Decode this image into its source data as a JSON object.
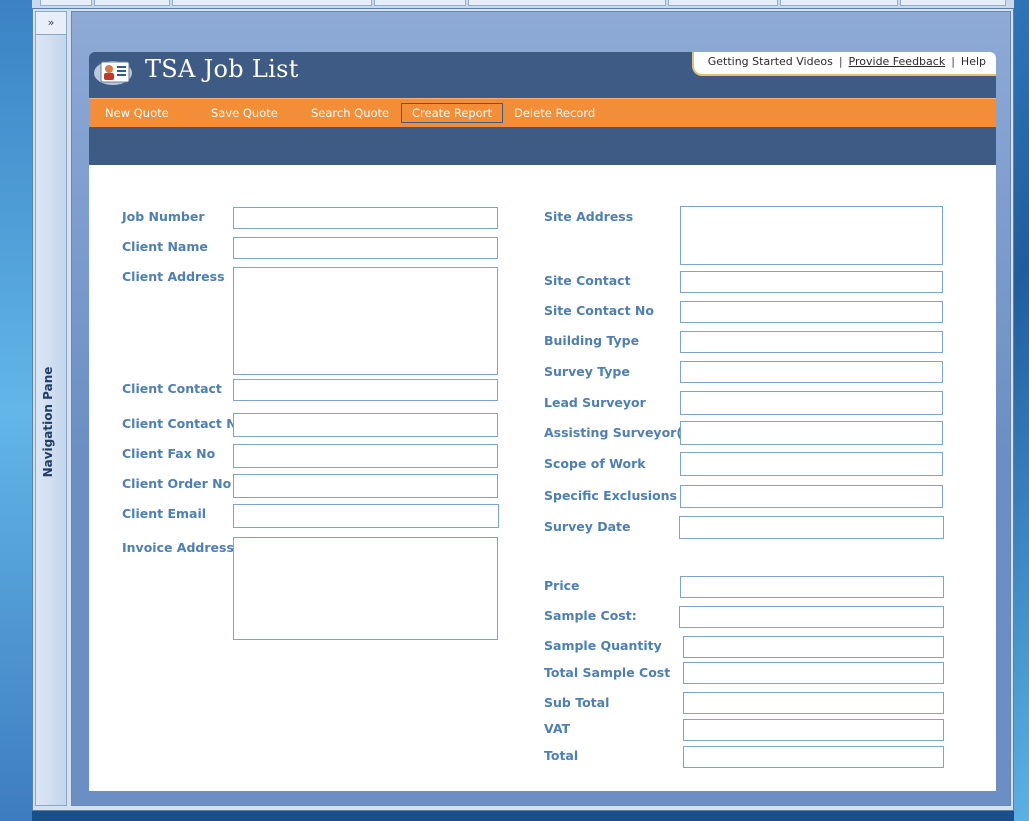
{
  "nav_pane": {
    "toggle": "»",
    "label": "Navigation Pane"
  },
  "header": {
    "title": "TSA Job List",
    "links": [
      "Getting Started Videos",
      "Provide Feedback",
      "Help"
    ]
  },
  "toolbar": {
    "new_quote": "New Quote",
    "save_quote": "Save Quote",
    "search_quote": "Search Quote",
    "create_report": "Create Report",
    "delete_record": "Delete Record"
  },
  "form": {
    "left": {
      "job_number": "Job Number",
      "client_name": "Client Name",
      "client_address": "Client Address",
      "client_contact": "Client Contact",
      "client_contact_no": "Client Contact No",
      "client_fax_no": "Client Fax No",
      "client_order_no": "Client Order No",
      "client_email": "Client Email",
      "invoice_address": "Invoice Address"
    },
    "right": {
      "site_address": "Site Address",
      "site_contact": "Site Contact",
      "site_contact_no": "Site Contact No",
      "building_type": "Building Type",
      "survey_type": "Survey Type",
      "lead_surveyor": "Lead Surveyor",
      "assisting_surveyors": "Assisting Surveyor(s)",
      "scope_of_work": "Scope of Work",
      "specific_exclusions": "Specific Exclusions",
      "survey_date": "Survey Date",
      "price": "Price",
      "sample_cost": "Sample Cost:",
      "sample_quantity": "Sample Quantity",
      "total_sample_cost": "Total Sample Cost",
      "sub_total": "Sub Total",
      "vat": "VAT",
      "total": "Total"
    }
  }
}
